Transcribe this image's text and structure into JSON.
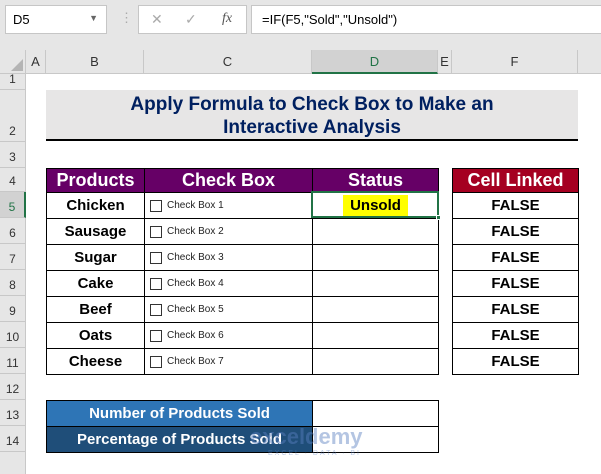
{
  "formula_bar": {
    "name_box": "D5",
    "formula": "=IF(F5,\"Sold\",\"Unsold\")",
    "fx": "fx",
    "cancel": "✕",
    "enter": "✓"
  },
  "columns": [
    "A",
    "B",
    "C",
    "D",
    "E",
    "F"
  ],
  "rows": [
    "1",
    "2",
    "3",
    "4",
    "5",
    "6",
    "7",
    "8",
    "9",
    "10",
    "11",
    "12",
    "13",
    "14"
  ],
  "title": {
    "line1": "Apply Formula to Check Box to Make an",
    "line2": "Interactive Analysis"
  },
  "table": {
    "headers": [
      "Products",
      "Check Box",
      "Status",
      "Cell Linked"
    ],
    "rows": [
      {
        "product": "Chicken",
        "checkbox": "Check Box 1",
        "status": "Unsold",
        "linked": "FALSE"
      },
      {
        "product": "Sausage",
        "checkbox": "Check Box 2",
        "status": "",
        "linked": "FALSE"
      },
      {
        "product": "Sugar",
        "checkbox": "Check Box 3",
        "status": "",
        "linked": "FALSE"
      },
      {
        "product": "Cake",
        "checkbox": "Check Box 4",
        "status": "",
        "linked": "FALSE"
      },
      {
        "product": "Beef",
        "checkbox": "Check Box 5",
        "status": "",
        "linked": "FALSE"
      },
      {
        "product": "Oats",
        "checkbox": "Check Box 6",
        "status": "",
        "linked": "FALSE"
      },
      {
        "product": "Cheese",
        "checkbox": "Check Box 7",
        "status": "",
        "linked": "FALSE"
      }
    ]
  },
  "summary": {
    "sold_label": "Number of Products Sold",
    "sold_value": "",
    "pct_label": "Percentage of Products Sold",
    "pct_value": ""
  },
  "watermark": {
    "name": "exceldemy",
    "tagline": "EXCEL · DATA · BI"
  },
  "colors": {
    "header": "#660066",
    "linked_header": "#a50021",
    "title_text": "#002060",
    "sum1": "#2e75b6",
    "sum2": "#1f4e79",
    "highlight": "#ffff00",
    "selection": "#217346"
  }
}
